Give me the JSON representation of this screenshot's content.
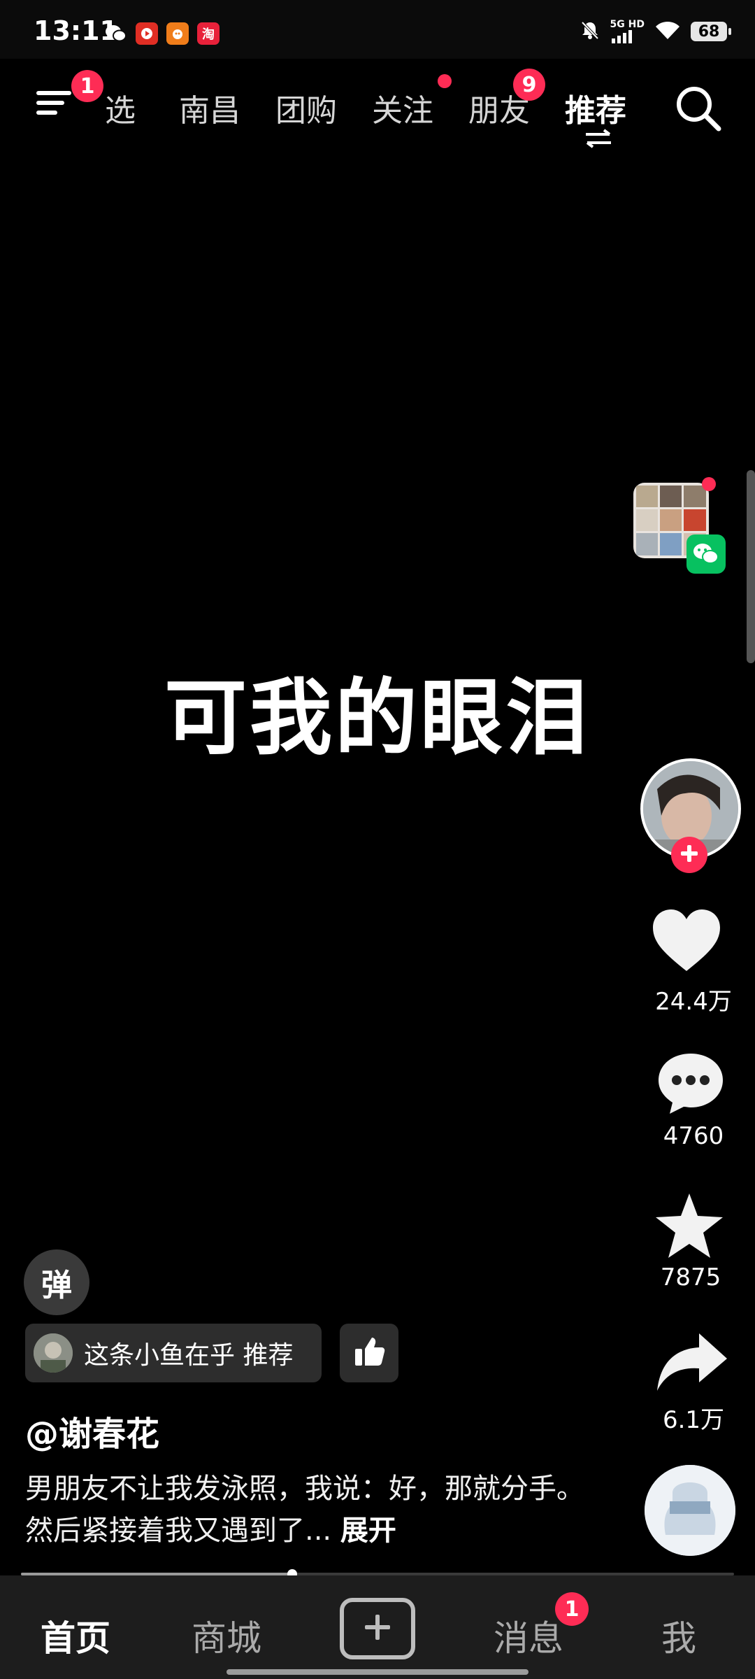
{
  "status_bar": {
    "time": "13:11",
    "network": "5G HD",
    "battery": "68"
  },
  "top_nav": {
    "menu_badge": "1",
    "tabs": [
      {
        "label": "精选",
        "visible_label": "选"
      },
      {
        "label": "南昌"
      },
      {
        "label": "团购"
      },
      {
        "label": "关注"
      },
      {
        "label": "朋友"
      },
      {
        "label": "推荐"
      }
    ],
    "friends_badge": "9"
  },
  "video": {
    "caption": "可我的眼泪"
  },
  "right_rail": {
    "like_count": "24.4万",
    "comment_count": "4760",
    "favorite_count": "7875",
    "share_count": "6.1万"
  },
  "bottom": {
    "danmaku_label": "弹",
    "recommend_chip": "这条小鱼在乎 推荐",
    "author": "@谢春花",
    "description": "男朋友不让我发泳照，我说：好，那就分手。 然后紧接着我又遇到了...",
    "expand_label": "展开",
    "progress": 0.38
  },
  "bottom_nav": {
    "items": [
      "首页",
      "商城",
      "消息",
      "我"
    ],
    "message_badge": "1"
  },
  "colors": {
    "accent": "#fe2c55",
    "wechat_green": "#07c160"
  }
}
